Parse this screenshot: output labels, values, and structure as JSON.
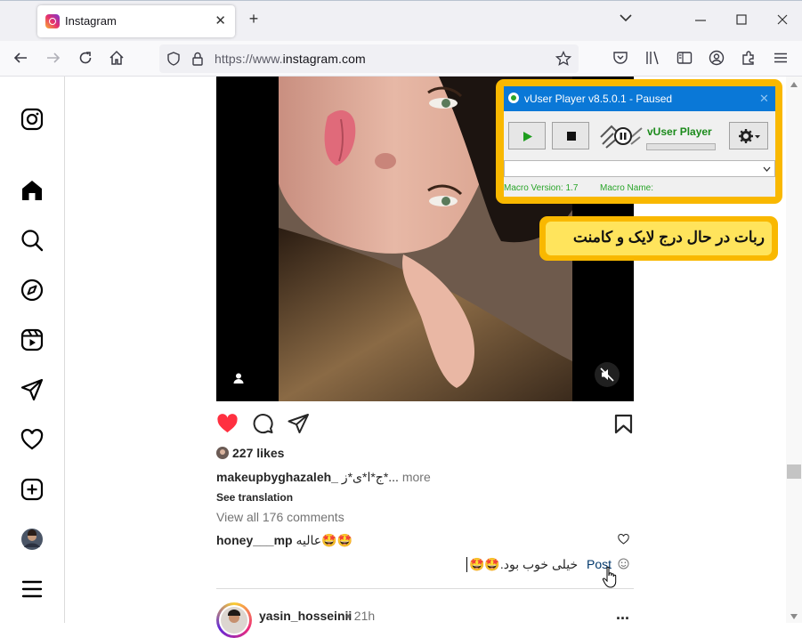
{
  "browser": {
    "tab_title": "Instagram",
    "url_prefix": "https://www.",
    "url_domain": "instagram.com",
    "new_tab_symbol": "+",
    "tab_list_symbol": "⌄"
  },
  "sidebar": {
    "items": [
      "instagram-logo-icon",
      "home-icon",
      "search-icon",
      "explore-icon",
      "reels-icon",
      "messages-icon",
      "notifications-icon",
      "create-icon",
      "profile-avatar",
      "more-menu-icon"
    ]
  },
  "post": {
    "likes": "227 likes",
    "username": "makeupbyghazaleh_",
    "caption": "ج*ا*ی*ز*...",
    "more": "more",
    "see_translation": "See translation",
    "view_comments": "View all 176 comments",
    "comment_user": "honey___mp",
    "comment_text": "عالیه🤩🤩",
    "compose_text": "خیلی خوب بود.🤩🤩",
    "post_button": "Post"
  },
  "next_post": {
    "username": "yasin_hosseinii",
    "time": "• 21h",
    "more": "..."
  },
  "vuser": {
    "title": "vUser Player v8.5.0.1 - Paused",
    "brand": "vUser Player",
    "macro_version_label": "Macro Version:",
    "macro_version": "1.7",
    "macro_name_label": "Macro Name:"
  },
  "banner": {
    "text": "ربات در حال درج لایک و کامنت"
  },
  "colors": {
    "like_red": "#ff3040",
    "accent_orange": "#f9b800",
    "vuser_blue": "#0a78d7",
    "post_blue": "#00376b"
  }
}
